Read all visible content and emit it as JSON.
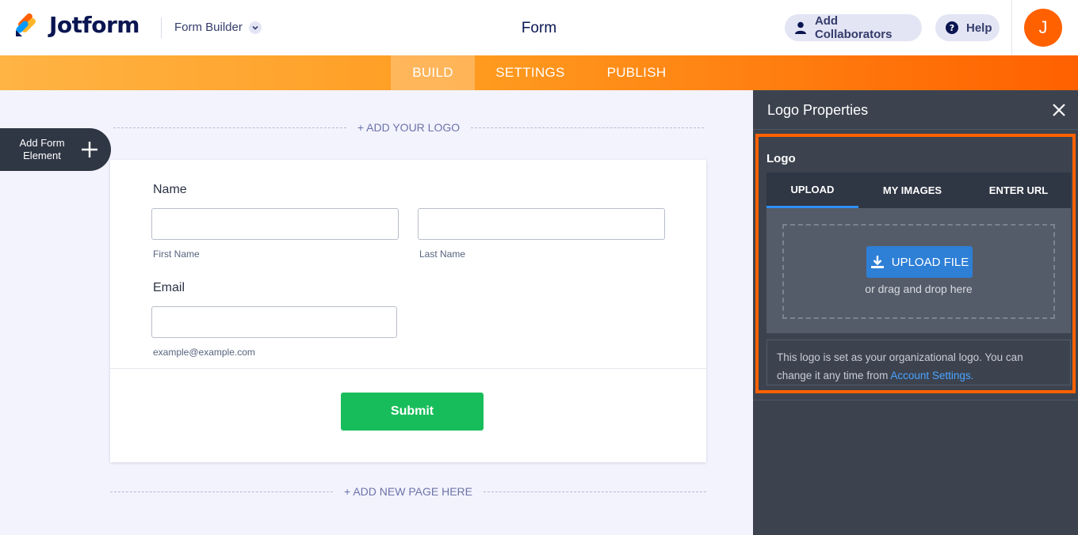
{
  "header": {
    "brand_name": "Jotform",
    "builder_label": "Form Builder",
    "page_title": "Form",
    "add_collaborators": "Add Collaborators",
    "help": "Help",
    "avatar_initial": "J"
  },
  "nav": {
    "tabs": [
      {
        "label": "BUILD",
        "active": true
      },
      {
        "label": "SETTINGS",
        "active": false
      },
      {
        "label": "PUBLISH",
        "active": false
      }
    ]
  },
  "sidebar": {
    "add_element_line1": "Add Form",
    "add_element_line2": "Element"
  },
  "canvas": {
    "add_logo": "+ ADD YOUR LOGO",
    "add_page": "+ ADD NEW PAGE HERE"
  },
  "form": {
    "name_label": "Name",
    "first_name_sub": "First Name",
    "last_name_sub": "Last Name",
    "email_label": "Email",
    "email_sub": "example@example.com",
    "submit_label": "Submit"
  },
  "panel": {
    "title": "Logo Properties",
    "logo_label": "Logo",
    "tabs": [
      {
        "label": "UPLOAD",
        "active": true
      },
      {
        "label": "MY IMAGES",
        "active": false
      },
      {
        "label": "ENTER URL",
        "active": false
      }
    ],
    "upload_button": "UPLOAD FILE",
    "drag_text": "or drag and drop here",
    "info_text": "This logo is set as your organizational logo. You can change it any time from",
    "info_link": "Account Settings."
  },
  "colors": {
    "accent": "#ff6100",
    "submit": "#18bd5b",
    "upload": "#2e7fd6",
    "link": "#4aa4ff",
    "panel_bg": "#3c434f"
  },
  "icons": [
    "jotform-logo-icon",
    "chevron-down-icon",
    "user-icon",
    "help-icon",
    "plus-icon",
    "close-icon",
    "download-icon"
  ]
}
